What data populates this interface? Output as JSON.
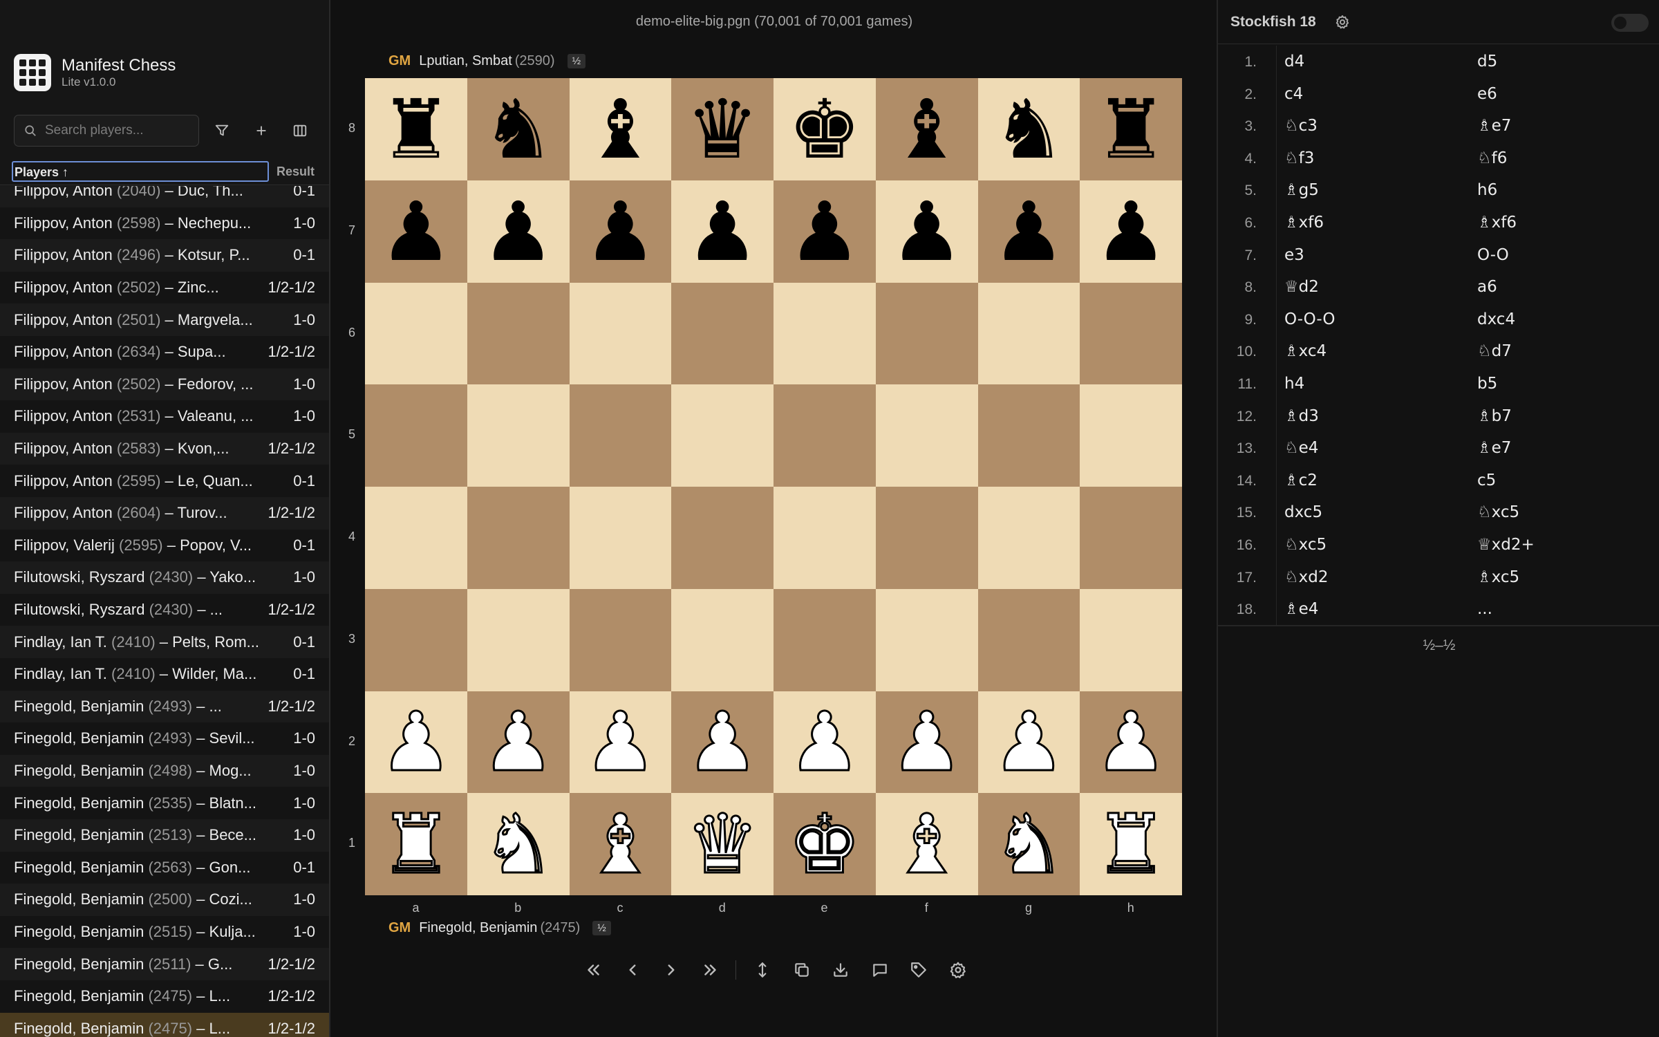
{
  "app": {
    "name": "Manifest Chess",
    "version": "Lite v1.0.0"
  },
  "search": {
    "placeholder": "Search players..."
  },
  "list": {
    "header_players": "Players ↑",
    "header_result": "Result",
    "rows": [
      {
        "white": "Filippov, Anton",
        "elo": "(2040)",
        "rest": " – Duc, Th...",
        "result": "0-1"
      },
      {
        "white": "Filippov, Anton",
        "elo": "(2598)",
        "rest": " – Nechepu...",
        "result": "1-0"
      },
      {
        "white": "Filippov, Anton",
        "elo": "(2496)",
        "rest": " – Kotsur, P...",
        "result": "0-1"
      },
      {
        "white": "Filippov, Anton",
        "elo": "(2502)",
        "rest": " – Zinc...",
        "result": "1/2-1/2"
      },
      {
        "white": "Filippov, Anton",
        "elo": "(2501)",
        "rest": " – Margvela...",
        "result": "1-0"
      },
      {
        "white": "Filippov, Anton",
        "elo": "(2634)",
        "rest": " – Supa...",
        "result": "1/2-1/2"
      },
      {
        "white": "Filippov, Anton",
        "elo": "(2502)",
        "rest": " – Fedorov, ...",
        "result": "1-0"
      },
      {
        "white": "Filippov, Anton",
        "elo": "(2531)",
        "rest": " – Valeanu, ...",
        "result": "1-0"
      },
      {
        "white": "Filippov, Anton",
        "elo": "(2583)",
        "rest": " – Kvon,...",
        "result": "1/2-1/2"
      },
      {
        "white": "Filippov, Anton",
        "elo": "(2595)",
        "rest": " – Le, Quan...",
        "result": "0-1"
      },
      {
        "white": "Filippov, Anton",
        "elo": "(2604)",
        "rest": " – Turov...",
        "result": "1/2-1/2"
      },
      {
        "white": "Filippov, Valerij",
        "elo": "(2595)",
        "rest": " – Popov, V...",
        "result": "0-1"
      },
      {
        "white": "Filutowski, Ryszard",
        "elo": "(2430)",
        "rest": " – Yako...",
        "result": "1-0"
      },
      {
        "white": "Filutowski, Ryszard",
        "elo": "(2430)",
        "rest": " – ...",
        "result": "1/2-1/2"
      },
      {
        "white": "Findlay, Ian T.",
        "elo": "(2410)",
        "rest": " – Pelts, Rom...",
        "result": "0-1"
      },
      {
        "white": "Findlay, Ian T.",
        "elo": "(2410)",
        "rest": " – Wilder, Ma...",
        "result": "0-1"
      },
      {
        "white": "Finegold, Benjamin",
        "elo": "(2493)",
        "rest": " – ...",
        "result": "1/2-1/2"
      },
      {
        "white": "Finegold, Benjamin",
        "elo": "(2493)",
        "rest": " – Sevil...",
        "result": "1-0"
      },
      {
        "white": "Finegold, Benjamin",
        "elo": "(2498)",
        "rest": " – Mog...",
        "result": "1-0"
      },
      {
        "white": "Finegold, Benjamin",
        "elo": "(2535)",
        "rest": " – Blatn...",
        "result": "1-0"
      },
      {
        "white": "Finegold, Benjamin",
        "elo": "(2513)",
        "rest": " – Bece...",
        "result": "1-0"
      },
      {
        "white": "Finegold, Benjamin",
        "elo": "(2563)",
        "rest": " – Gon...",
        "result": "0-1"
      },
      {
        "white": "Finegold, Benjamin",
        "elo": "(2500)",
        "rest": " – Cozi...",
        "result": "1-0"
      },
      {
        "white": "Finegold, Benjamin",
        "elo": "(2515)",
        "rest": " – Kulja...",
        "result": "1-0"
      },
      {
        "white": "Finegold, Benjamin",
        "elo": "(2511)",
        "rest": " – G...",
        "result": "1/2-1/2"
      },
      {
        "white": "Finegold, Benjamin",
        "elo": "(2475)",
        "rest": " – L...",
        "result": "1/2-1/2"
      },
      {
        "white": "Finegold, Benjamin",
        "elo": "(2475)",
        "rest": " – L...",
        "result": "1/2-1/2",
        "selected": true
      }
    ]
  },
  "center": {
    "file_title": "demo-elite-big.pgn (70,001 of 70,001 games)",
    "top_player": {
      "title": "GM",
      "name": "Lputian, Smbat",
      "elo": "(2590)",
      "score": "½"
    },
    "bottom_player": {
      "title": "GM",
      "name": "Finegold, Benjamin",
      "elo": "(2475)",
      "score": "½"
    },
    "ranks": [
      "8",
      "7",
      "6",
      "5",
      "4",
      "3",
      "2",
      "1"
    ],
    "files": [
      "a",
      "b",
      "c",
      "d",
      "e",
      "f",
      "g",
      "h"
    ],
    "board": [
      [
        "bR",
        "bN",
        "bB",
        "bQ",
        "bK",
        "bB",
        "bN",
        "bR"
      ],
      [
        "bP",
        "bP",
        "bP",
        "bP",
        "bP",
        "bP",
        "bP",
        "bP"
      ],
      [
        "",
        "",
        "",
        "",
        "",
        "",
        "",
        ""
      ],
      [
        "",
        "",
        "",
        "",
        "",
        "",
        "",
        ""
      ],
      [
        "",
        "",
        "",
        "",
        "",
        "",
        "",
        ""
      ],
      [
        "",
        "",
        "",
        "",
        "",
        "",
        "",
        ""
      ],
      [
        "wP",
        "wP",
        "wP",
        "wP",
        "wP",
        "wP",
        "wP",
        "wP"
      ],
      [
        "wR",
        "wN",
        "wB",
        "wQ",
        "wK",
        "wB",
        "wN",
        "wR"
      ]
    ],
    "controls": [
      "first-move",
      "previous-move",
      "next-move",
      "last-move",
      "flip-board",
      "copy",
      "download",
      "comment",
      "tag",
      "settings"
    ]
  },
  "engine": {
    "name": "Stockfish 18",
    "enabled": false,
    "moves": [
      [
        "1.",
        "d4",
        "d5"
      ],
      [
        "2.",
        "c4",
        "e6"
      ],
      [
        "3.",
        "♘c3",
        "♗e7"
      ],
      [
        "4.",
        "♘f3",
        "♘f6"
      ],
      [
        "5.",
        "♗g5",
        "h6"
      ],
      [
        "6.",
        "♗xf6",
        "♗xf6"
      ],
      [
        "7.",
        "e3",
        "O-O"
      ],
      [
        "8.",
        "♕d2",
        "a6"
      ],
      [
        "9.",
        "O-O-O",
        "dxc4"
      ],
      [
        "10.",
        "♗xc4",
        "♘d7"
      ],
      [
        "11.",
        "h4",
        "b5"
      ],
      [
        "12.",
        "♗d3",
        "♗b7"
      ],
      [
        "13.",
        "♘e4",
        "♗e7"
      ],
      [
        "14.",
        "♗c2",
        "c5"
      ],
      [
        "15.",
        "dxc5",
        "♘xc5"
      ],
      [
        "16.",
        "♘xc5",
        "♕xd2+"
      ],
      [
        "17.",
        "♘xd2",
        "♗xc5"
      ],
      [
        "18.",
        "♗e4",
        "..."
      ]
    ],
    "final_result": "½–½"
  },
  "colors": {
    "accent": "#e0a542",
    "light_square": "#efdbb5",
    "dark_square": "#b08d68",
    "selected_row": "#4a3b1f",
    "focus_ring": "#6d8fd6"
  }
}
